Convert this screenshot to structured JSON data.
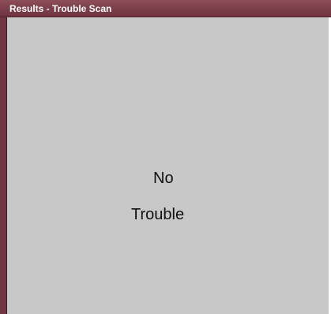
{
  "window": {
    "title": "Results - Trouble Scan"
  },
  "result": {
    "line1": "No",
    "line2": "Trouble"
  },
  "colors": {
    "titlebar": "#7a3e4a",
    "content_background": "#c8c8c8",
    "text": "#111111"
  }
}
